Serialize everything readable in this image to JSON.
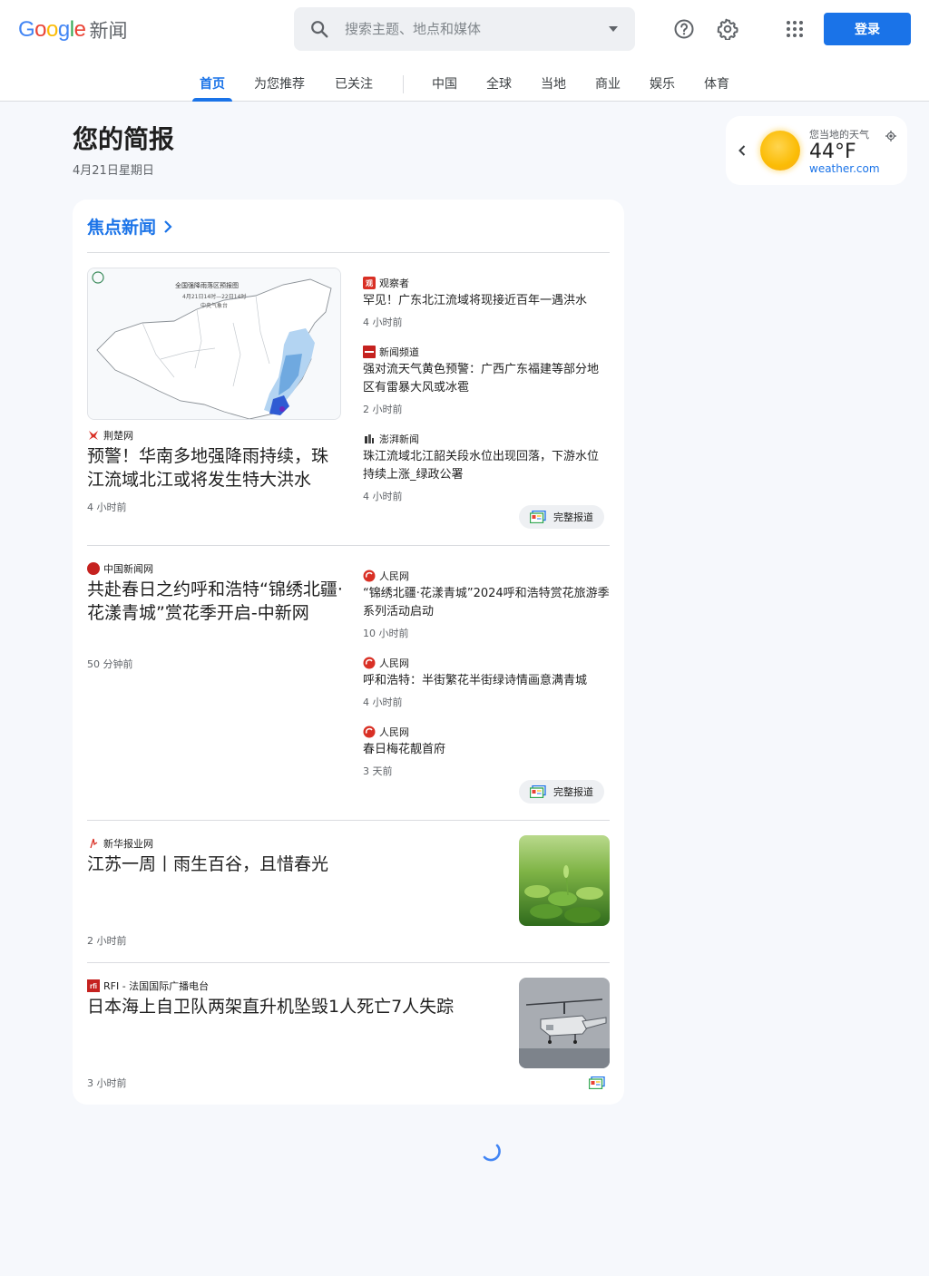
{
  "header": {
    "logo_letters": [
      "G",
      "o",
      "o",
      "g",
      "l",
      "e"
    ],
    "logo_news": "新闻",
    "search_placeholder": "搜索主题、地点和媒体",
    "login_label": "登录",
    "icons": [
      "search-icon",
      "caret-down-icon",
      "help-icon",
      "gear-icon",
      "apps-grid-icon"
    ]
  },
  "tabs": {
    "items": [
      "首页",
      "为您推荐",
      "已关注",
      "中国",
      "全球",
      "当地",
      "商业",
      "娱乐",
      "体育"
    ],
    "active": "首页"
  },
  "briefing": {
    "title": "您的简报",
    "date": "4月21日星期日"
  },
  "weather": {
    "label": "您当地的天气",
    "temp": "44°F",
    "source": "weather.com",
    "icons": [
      "chevron-left-icon",
      "sun-icon",
      "location-icon"
    ]
  },
  "top_stories": {
    "heading": "焦点新闻",
    "clusters": [
      {
        "main": {
          "source": "荆楚网",
          "title": "预警！华南多地强降雨持续，珠江流域北江或将发生特大洪水",
          "time": "4 小时前",
          "image_caption": "全国强降雨落区预报图",
          "image_sub": "4月21日14时—22日14时",
          "image_agency": "中央气象台"
        },
        "related": [
          {
            "source": "观察者",
            "title": "罕见！广东北江流域将现接近百年一遇洪水",
            "time": "4 小时前"
          },
          {
            "source": "新闻频道",
            "title": "强对流天气黄色预警：广西广东福建等部分地区有雷暴大风或冰雹",
            "time": "2 小时前"
          },
          {
            "source": "澎湃新闻",
            "title": "珠江流域北江韶关段水位出现回落，下游水位持续上涨_绿政公署",
            "time": "4 小时前"
          }
        ],
        "full_coverage": "完整报道"
      },
      {
        "main": {
          "source": "中国新闻网",
          "title": "共赴春日之约呼和浩特“锦绣北疆·花漾青城”赏花季开启-中新网",
          "time": "50 分钟前"
        },
        "related": [
          {
            "source": "人民网",
            "title": "“锦绣北疆·花漾青城”2024呼和浩特赏花旅游季系列活动启动",
            "time": "10 小时前"
          },
          {
            "source": "人民网",
            "title": "呼和浩特：半街繁花半街绿诗情画意满青城",
            "time": "4 小时前"
          },
          {
            "source": "人民网",
            "title": "春日梅花靓首府",
            "time": "3 天前"
          }
        ],
        "full_coverage": "完整报道"
      }
    ],
    "singles": [
      {
        "source": "新华报业网",
        "title": "江苏一周丨雨生百谷，且惜春光",
        "time": "2 小时前"
      },
      {
        "source": "RFI - 法国国际广播电台",
        "title": "日本海上自卫队两架直升机坠毁1人死亡7人失踪",
        "time": "3 小时前"
      }
    ]
  },
  "colors": {
    "accent": "#1a73e8",
    "background": "#f6f8fc",
    "card": "#ffffff"
  }
}
